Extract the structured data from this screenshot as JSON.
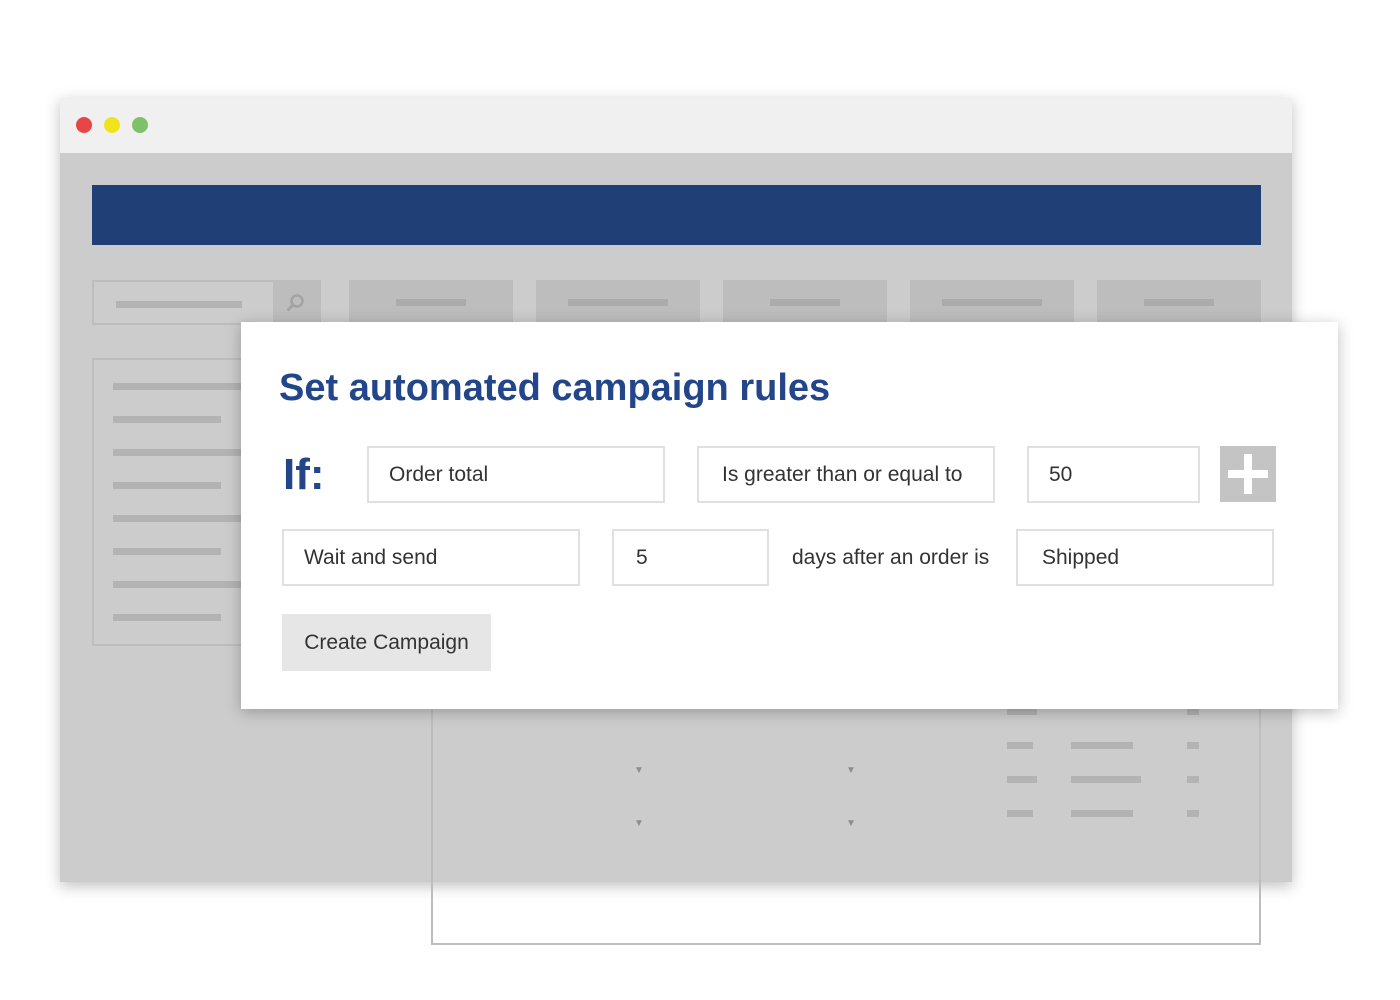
{
  "window": {
    "controls": [
      {
        "name": "close",
        "color": "#e84646"
      },
      {
        "name": "minimize",
        "color": "#f0e41e"
      },
      {
        "name": "maximize",
        "color": "#7ec16a"
      }
    ],
    "header_color": "#213f77"
  },
  "background": {
    "search_icon": "search-icon",
    "tabs_count": 5,
    "dropdown_icon": "chevron-down-icon"
  },
  "modal": {
    "title": "Set automated campaign rules",
    "condition": {
      "if_label": "If:",
      "field": "Order total",
      "operator": "Is greater than or equal to",
      "value": "50",
      "add_icon": "plus-icon"
    },
    "action": {
      "action": "Wait and send",
      "days": "5",
      "connector_text": "days after an order is",
      "status": "Shipped"
    },
    "submit_label": "Create Campaign"
  },
  "colors": {
    "accent": "#23468b",
    "button_bg": "#e6e6e6",
    "plus_bg": "#c4c4c4"
  }
}
